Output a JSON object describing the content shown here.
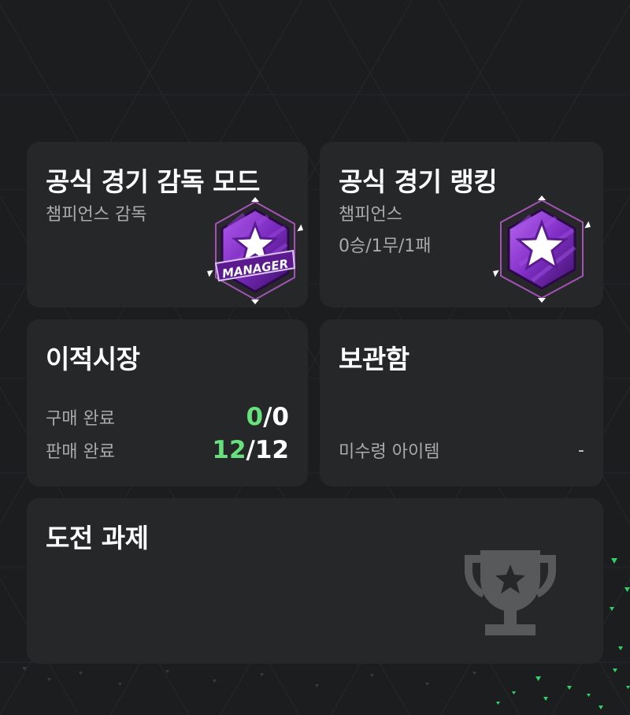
{
  "cards": {
    "manager_mode": {
      "title": "공식 경기 감독 모드",
      "subtitle": "챔피언스 감독",
      "badge_icon": "manager-star-badge-icon",
      "badge_text": "MANAGER"
    },
    "ranking": {
      "title": "공식 경기 랭킹",
      "subtitle": "챔피언스",
      "record": "0승/1무/1패",
      "badge_icon": "champion-star-badge-icon"
    },
    "transfer_market": {
      "title": "이적시장",
      "rows": [
        {
          "label": "구매 완료",
          "done": "0",
          "separator": "/",
          "total": "0"
        },
        {
          "label": "판매 완료",
          "done": "12",
          "separator": "/",
          "total": "12"
        }
      ]
    },
    "storage": {
      "title": "보관함",
      "unclaimed_label": "미수령 아이템",
      "unclaimed_value": "-"
    },
    "challenges": {
      "title": "도전 과제",
      "icon": "trophy-icon"
    }
  },
  "colors": {
    "background": "#1c1d1f",
    "card": "#262728",
    "accent_green": "#68e17c",
    "muted_text": "#a9aaab",
    "badge_purple": "#8a3bd0"
  }
}
